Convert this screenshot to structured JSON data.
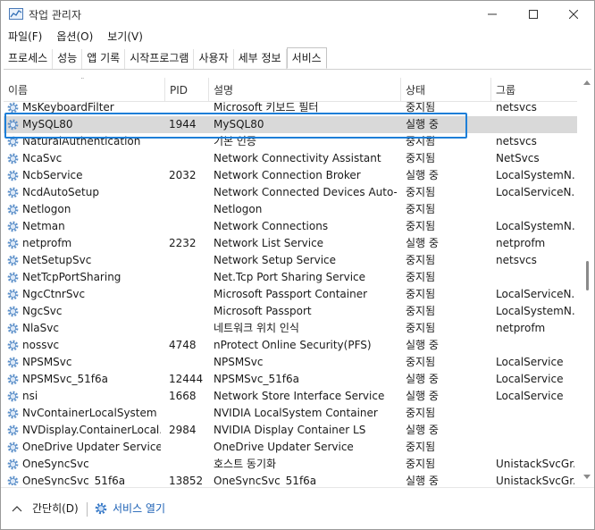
{
  "window": {
    "title": "작업 관리자"
  },
  "menu": [
    {
      "label": "파일(F)"
    },
    {
      "label": "옵션(O)"
    },
    {
      "label": "보기(V)"
    }
  ],
  "tabs": [
    {
      "label": "프로세스"
    },
    {
      "label": "성능"
    },
    {
      "label": "앱 기록"
    },
    {
      "label": "시작프로그램"
    },
    {
      "label": "사용자"
    },
    {
      "label": "세부 정보"
    },
    {
      "label": "서비스",
      "active": true
    }
  ],
  "columns": {
    "name": "이름",
    "pid": "PID",
    "desc": "설명",
    "status": "상태",
    "group": "그룹"
  },
  "rows": [
    {
      "name": "MsKeyboardFilter",
      "pid": "",
      "desc": "Microsoft 키보드 필터",
      "status": "중지됨",
      "group": "netsvcs"
    },
    {
      "name": "MySQL80",
      "pid": "1944",
      "desc": "MySQL80",
      "status": "실행 중",
      "group": "",
      "selected": true
    },
    {
      "name": "NaturalAuthentication",
      "pid": "",
      "desc": "기본 인증",
      "status": "중지됨",
      "group": "netsvcs"
    },
    {
      "name": "NcaSvc",
      "pid": "",
      "desc": "Network Connectivity Assistant",
      "status": "중지됨",
      "group": "NetSvcs"
    },
    {
      "name": "NcbService",
      "pid": "2032",
      "desc": "Network Connection Broker",
      "status": "실행 중",
      "group": "LocalSystemN..."
    },
    {
      "name": "NcdAutoSetup",
      "pid": "",
      "desc": "Network Connected Devices Auto-...",
      "status": "중지됨",
      "group": "LocalServiceN..."
    },
    {
      "name": "Netlogon",
      "pid": "",
      "desc": "Netlogon",
      "status": "중지됨",
      "group": ""
    },
    {
      "name": "Netman",
      "pid": "",
      "desc": "Network Connections",
      "status": "중지됨",
      "group": "LocalSystemN..."
    },
    {
      "name": "netprofm",
      "pid": "2232",
      "desc": "Network List Service",
      "status": "실행 중",
      "group": "netprofm"
    },
    {
      "name": "NetSetupSvc",
      "pid": "",
      "desc": "Network Setup Service",
      "status": "중지됨",
      "group": "netsvcs"
    },
    {
      "name": "NetTcpPortSharing",
      "pid": "",
      "desc": "Net.Tcp Port Sharing Service",
      "status": "중지됨",
      "group": ""
    },
    {
      "name": "NgcCtnrSvc",
      "pid": "",
      "desc": "Microsoft Passport Container",
      "status": "중지됨",
      "group": "LocalServiceN..."
    },
    {
      "name": "NgcSvc",
      "pid": "",
      "desc": "Microsoft Passport",
      "status": "중지됨",
      "group": "LocalSystemN..."
    },
    {
      "name": "NlaSvc",
      "pid": "",
      "desc": "네트워크 위치 인식",
      "status": "중지됨",
      "group": "netprofm"
    },
    {
      "name": "nossvc",
      "pid": "4748",
      "desc": "nProtect Online Security(PFS)",
      "status": "실행 중",
      "group": ""
    },
    {
      "name": "NPSMSvc",
      "pid": "",
      "desc": "NPSMSvc",
      "status": "중지됨",
      "group": "LocalService"
    },
    {
      "name": "NPSMSvc_51f6a",
      "pid": "12444",
      "desc": "NPSMSvc_51f6a",
      "status": "실행 중",
      "group": "LocalService"
    },
    {
      "name": "nsi",
      "pid": "1668",
      "desc": "Network Store Interface Service",
      "status": "실행 중",
      "group": "LocalService"
    },
    {
      "name": "NvContainerLocalSystem",
      "pid": "",
      "desc": "NVIDIA LocalSystem Container",
      "status": "중지됨",
      "group": ""
    },
    {
      "name": "NVDisplay.ContainerLocal...",
      "pid": "2984",
      "desc": "NVIDIA Display Container LS",
      "status": "실행 중",
      "group": ""
    },
    {
      "name": "OneDrive Updater Service",
      "pid": "",
      "desc": "OneDrive Updater Service",
      "status": "중지됨",
      "group": ""
    },
    {
      "name": "OneSyncSvc",
      "pid": "",
      "desc": "호스트 동기화",
      "status": "중지됨",
      "group": "UnistackSvcGr..."
    },
    {
      "name": "OneSyncSvc_51f6a",
      "pid": "13852",
      "desc": "OneSyncSvc_51f6a",
      "status": "실행 중",
      "group": "UnistackSvcGr..."
    }
  ],
  "footer": {
    "less_label": "간단히(D)",
    "open_services_label": "서비스 열기"
  },
  "colors": {
    "selection_outline": "#1e7fd8",
    "selected_row": "#d9d9d9",
    "link": "#1a5fb4"
  }
}
